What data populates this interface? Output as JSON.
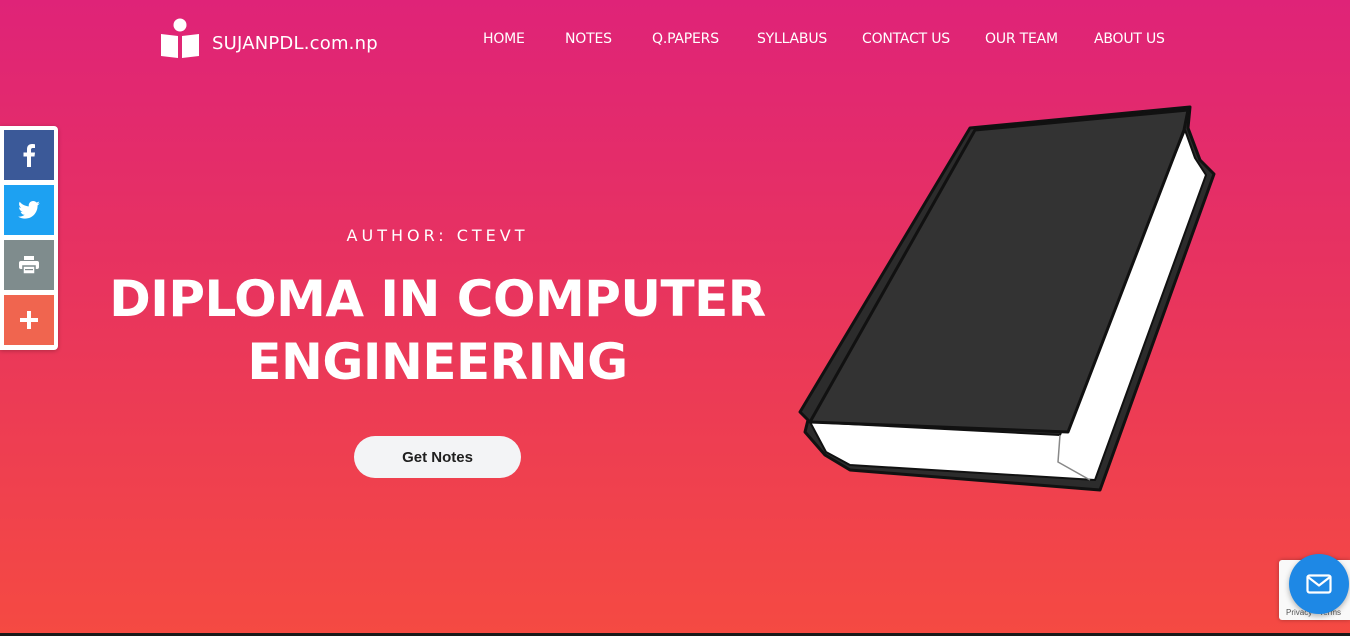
{
  "header": {
    "logo_text": "SUJANPDL.com.np",
    "nav": [
      "HOME",
      "NOTES",
      "Q.PAPERS",
      "SYLLABUS",
      "CONTACT US",
      "OUR TEAM",
      "ABOUT US"
    ]
  },
  "social": {
    "buttons": [
      {
        "name": "facebook",
        "icon": "facebook-icon",
        "color": "#3b5998"
      },
      {
        "name": "twitter",
        "icon": "twitter-icon",
        "color": "#1da1f2"
      },
      {
        "name": "print",
        "icon": "print-icon",
        "color": "#7f8c8d"
      },
      {
        "name": "more",
        "icon": "plus-icon",
        "color": "#f0654f"
      }
    ]
  },
  "hero": {
    "author": "AUTHOR: CTEVT",
    "title_line1": "DIPLOMA IN COMPUTER",
    "title_line2": "ENGINEERING",
    "cta_label": "Get Notes",
    "illustration": "book-icon"
  },
  "recaptcha": {
    "privacy": "Privacy",
    "separator": " - ",
    "terms": "Terms"
  },
  "chat": {
    "icon": "mail-icon",
    "color": "#1e88e5"
  },
  "theme": {
    "gradient_top": "#df2378",
    "gradient_bottom": "#f54a42"
  }
}
